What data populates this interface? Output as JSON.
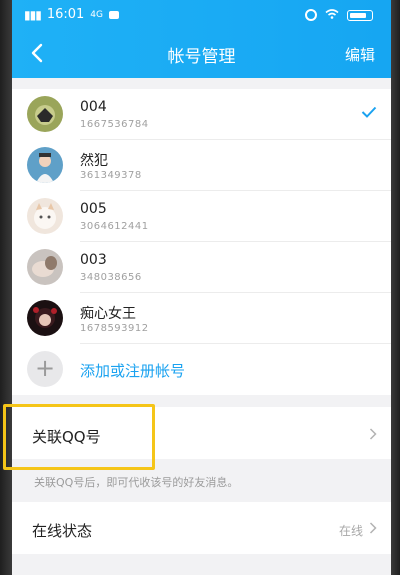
{
  "status": {
    "time": "16:01",
    "network": "4G"
  },
  "header": {
    "title": "帐号管理",
    "edit": "编辑"
  },
  "accounts": [
    {
      "name": "004",
      "number": "1667536784",
      "selected": true
    },
    {
      "name": "然犯",
      "number": "361349378"
    },
    {
      "name": "005",
      "number": "3064612441"
    },
    {
      "name": "003",
      "number": "348038656"
    },
    {
      "name": "痴心女王",
      "number": "1678593912"
    }
  ],
  "add_account": {
    "label": "添加或注册帐号"
  },
  "associate": {
    "label": "关联QQ号",
    "hint": "关联QQ号后，即可代收该号的好友消息。"
  },
  "online_status": {
    "label": "在线状态",
    "value": "在线"
  },
  "colors": {
    "accent": "#1aa2f0",
    "highlight": "#f5c518"
  }
}
